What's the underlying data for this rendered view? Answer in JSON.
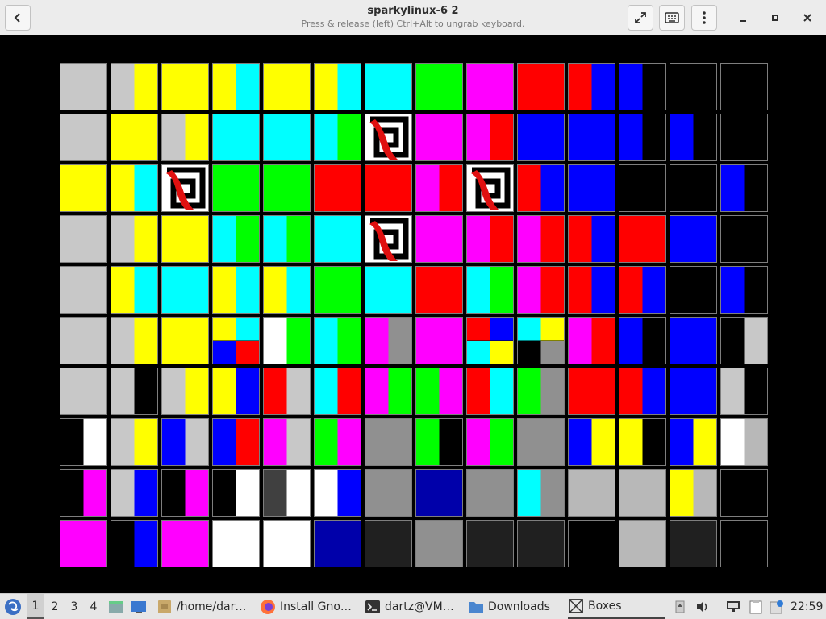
{
  "window": {
    "title": "sparkylinux-6 2",
    "subtitle": "Press & release (left) Ctrl+Alt to ungrab keyboard."
  },
  "colors": {
    "titlebar_bg": "#ececec",
    "display_bg": "#000000",
    "taskbar_bg": "#e6e6e6",
    "tile_border": "#7e7e7e"
  },
  "palette": {
    "G": "#c8c8c8",
    "Y": "#ffff00",
    "C": "#00ffff",
    "N": "#00ff00",
    "M": "#ff00ff",
    "R": "#ff0000",
    "B": "#0000ff",
    "K": "#000000",
    "D": "#0000aa",
    "W": "#ffffff",
    "S": "#909090",
    "X": "#202020",
    "L": "#b8b8b8",
    "Q": "#404040",
    "V": "#cc00cc"
  },
  "display": {
    "tiles": [
      [
        "G",
        "GY",
        "Y",
        "YC",
        "Y",
        "YC",
        "C",
        "N",
        "M",
        "R",
        "RB",
        "BK",
        "K",
        "K"
      ],
      [
        "G",
        "Y",
        "GY",
        "C",
        "C",
        "CN",
        "art",
        "M",
        "MR",
        "B",
        "B",
        "BK",
        "BK",
        "K"
      ],
      [
        "Y",
        "YC",
        "art",
        "N",
        "N",
        "R",
        "R",
        "MR",
        "art",
        "RB",
        "B",
        "K",
        "K",
        "BK"
      ],
      [
        "G",
        "GY",
        "Y",
        "CN",
        "CN",
        "C",
        "art",
        "M",
        "MR",
        "MR",
        "RB",
        "R",
        "B",
        "K"
      ],
      [
        "G",
        "YC",
        "C",
        "YC",
        "YC",
        "N",
        "C",
        "R",
        "CN",
        "MR",
        "RB",
        "RB",
        "K",
        "BK"
      ],
      [
        "G",
        "GY",
        "Y",
        "YCBR",
        "WN",
        "CN",
        "MS",
        "M",
        "RBCY",
        "CYKS",
        "MR",
        "BK",
        "B",
        "KG"
      ],
      [
        "G",
        "GK",
        "GY",
        "YB",
        "RG",
        "CR",
        "MN",
        "NM",
        "RC",
        "NS",
        "R",
        "RB",
        "B",
        "GK"
      ],
      [
        "KW",
        "GY",
        "BG",
        "BR",
        "MG",
        "NM",
        "S",
        "NK",
        "MN",
        "S",
        "BY",
        "YK",
        "BY",
        "WL"
      ],
      [
        "KM",
        "GB",
        "KM",
        "KW",
        "QW",
        "WB",
        "S",
        "D",
        "S",
        "CS",
        "L",
        "L",
        "YL",
        "K"
      ],
      [
        "M",
        "KB",
        "M",
        "W",
        "W",
        "D",
        "X",
        "S",
        "X",
        "X",
        "K",
        "L",
        "X",
        "K"
      ]
    ]
  },
  "taskbar": {
    "launcher": "menu-icon",
    "workspaces": [
      "1",
      "2",
      "3",
      "4"
    ],
    "active_workspace": "1",
    "tasks": [
      {
        "label": "/home/dar…",
        "icon": "folder-icon"
      },
      {
        "label": "Install Gno…",
        "icon": "firefox-icon"
      },
      {
        "label": "dartz@VM…",
        "icon": "terminal-icon"
      },
      {
        "label": "Downloads",
        "icon": "folder-icon"
      },
      {
        "label": "Boxes",
        "icon": "boxes-icon",
        "active": true
      }
    ],
    "tray": [
      "upload-icon",
      "volume-icon",
      "network-icon",
      "clipboard-icon",
      "updates-icon"
    ],
    "clock": "22:59"
  }
}
